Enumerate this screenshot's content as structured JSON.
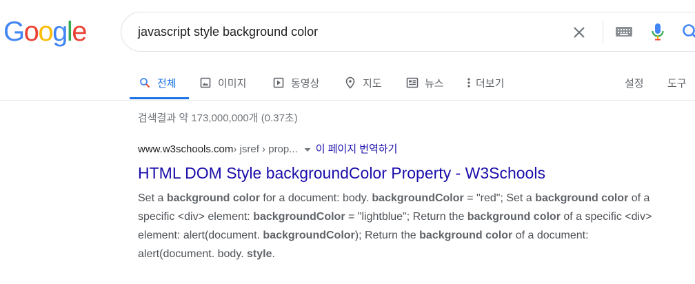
{
  "logo": {
    "text": "Google",
    "letters": [
      {
        "ch": "G",
        "color": "#4285F4"
      },
      {
        "ch": "o",
        "color": "#EA4335"
      },
      {
        "ch": "o",
        "color": "#FBBC05"
      },
      {
        "ch": "g",
        "color": "#4285F4"
      },
      {
        "ch": "l",
        "color": "#34A853"
      },
      {
        "ch": "e",
        "color": "#EA4335"
      }
    ]
  },
  "search": {
    "query": "javascript style background color",
    "icons": [
      "close-icon",
      "keyboard-icon",
      "mic-icon",
      "search-icon"
    ]
  },
  "tabs": {
    "all": "전체",
    "images": "이미지",
    "videos": "동영상",
    "maps": "지도",
    "news": "뉴스",
    "more": "더보기",
    "settings": "설정",
    "tools": "도구"
  },
  "stats": "검색결과 약 173,000,000개 (0.37초)",
  "result": {
    "domain": "www.w3schools.com",
    "path": " › jsref › prop...",
    "translate": "이 페이지 번역하기",
    "title": "HTML DOM Style backgroundColor Property - W3Schools",
    "snippet": [
      {
        "t": "Set a ",
        "b": false
      },
      {
        "t": "background color",
        "b": true
      },
      {
        "t": " for a document: body. ",
        "b": false
      },
      {
        "t": "backgroundColor",
        "b": true
      },
      {
        "t": " = \"red\"; Set a ",
        "b": false
      },
      {
        "t": "background color",
        "b": true
      },
      {
        "t": " of a specific <div> element: ",
        "b": false
      },
      {
        "t": "backgroundColor",
        "b": true
      },
      {
        "t": " = \"lightblue\"; Return the ",
        "b": false
      },
      {
        "t": "background color",
        "b": true
      },
      {
        "t": " of a specific <div> element: alert(document. ",
        "b": false
      },
      {
        "t": "backgroundColor",
        "b": true
      },
      {
        "t": "); Return the ",
        "b": false
      },
      {
        "t": "background color",
        "b": true
      },
      {
        "t": " of a document: alert(document. body. ",
        "b": false
      },
      {
        "t": "style",
        "b": true
      },
      {
        "t": ".",
        "b": false
      }
    ]
  },
  "colors": {
    "accent": "#1a73e8",
    "link": "#1a0dab",
    "muted": "#70757a"
  }
}
